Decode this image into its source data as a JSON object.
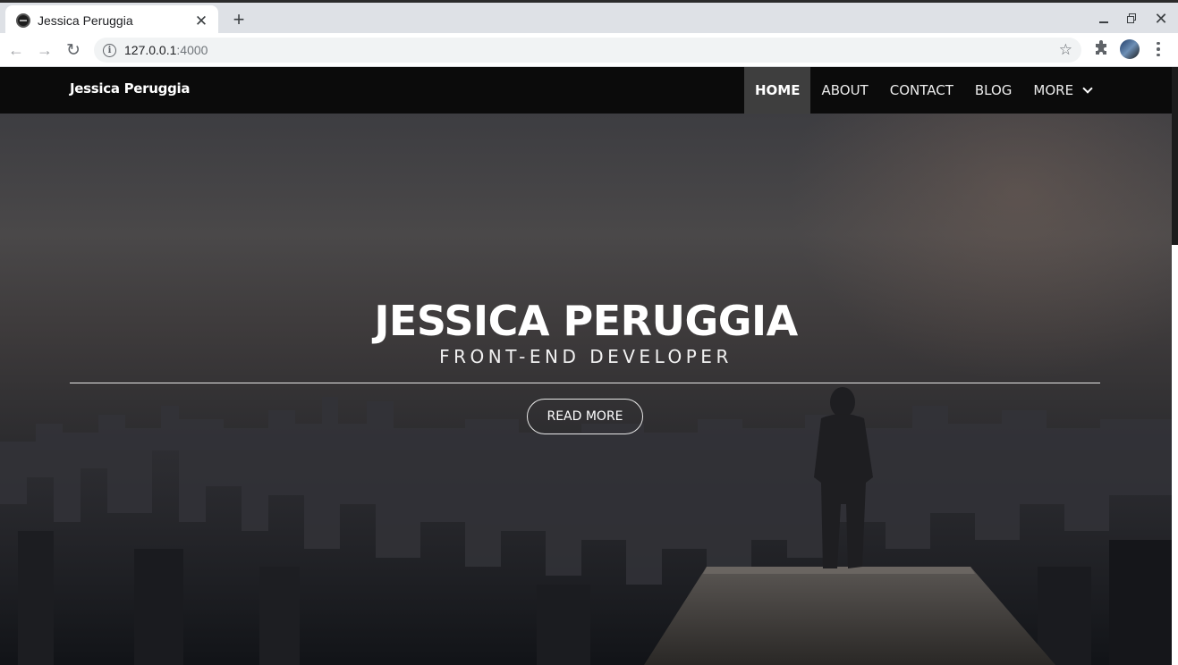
{
  "browser": {
    "tab_title": "Jessica Peruggia",
    "tab_close": "✕",
    "new_tab": "+",
    "close_window": "✕",
    "url_host": "127.0.0.1",
    "url_port": ":4000",
    "back": "←",
    "forward": "→",
    "reload": "↻",
    "star": "☆",
    "info": "i"
  },
  "site": {
    "brand": "Jessica Peruggia",
    "nav": [
      {
        "label": "HOME",
        "active": true
      },
      {
        "label": "ABOUT"
      },
      {
        "label": "CONTACT"
      },
      {
        "label": "BLOG"
      },
      {
        "label": "MORE"
      }
    ]
  },
  "hero": {
    "title": "JESSICA PERUGGIA",
    "subtitle": "FRONT-END DEVELOPER",
    "button_label": "READ MORE"
  },
  "colors": {
    "nav_bg": "#0b0b0b",
    "nav_active_bg": "#3e3e3e",
    "hero_text": "#ffffff"
  }
}
